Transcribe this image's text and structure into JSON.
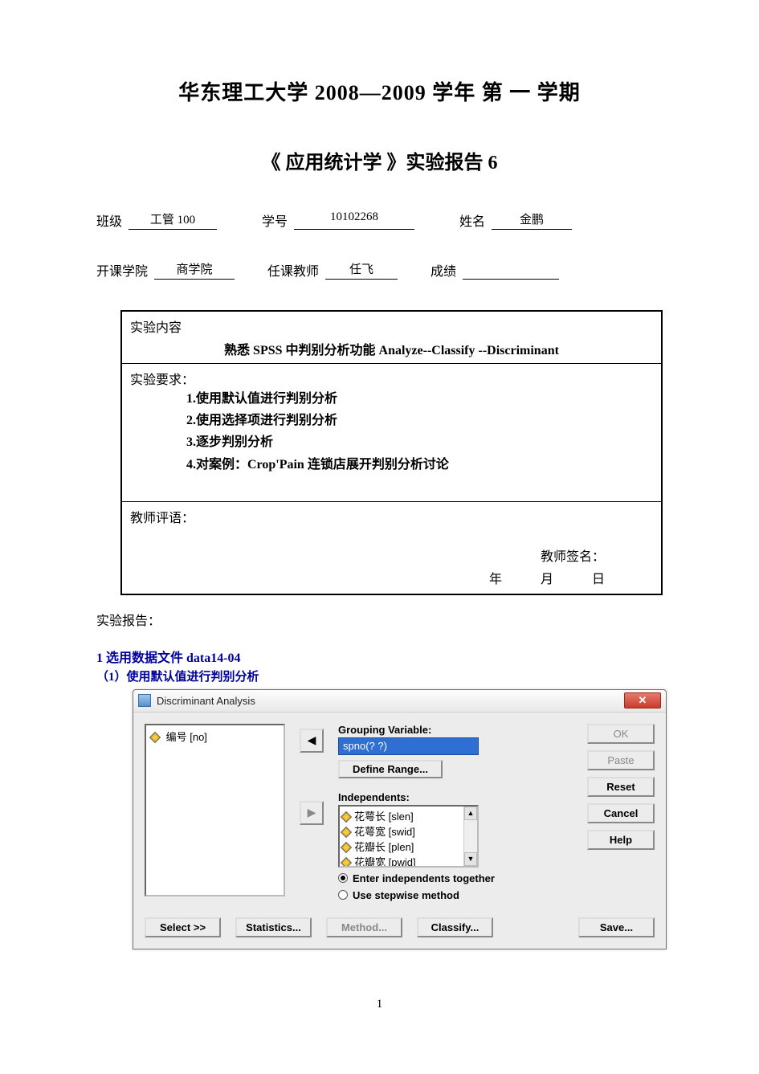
{
  "header": {
    "title": "华东理工大学 2008—2009  学年  第  一  学期",
    "subtitle": "《  应用统计学  》实验报告 6"
  },
  "info1": {
    "class_label": "班级",
    "class_value": "工管 100",
    "id_label": "学号",
    "id_value": "10102268",
    "name_label": "姓名",
    "name_value": "金鹏"
  },
  "info2": {
    "college_label": "开课学院",
    "college_value": "商学院",
    "teacher_label": "任课教师",
    "teacher_value": "任飞",
    "score_label": "成绩",
    "score_value": ""
  },
  "box": {
    "content_label": "实验内容",
    "content_text": "熟悉 SPSS 中判别分析功能 Analyze--Classify  --Discriminant",
    "req_label": "实验要求：",
    "reqs": [
      "1.使用默认值进行判别分析",
      "2.使用选择项进行判别分析",
      "3.逐步判别分析",
      "4.对案例：Crop'Pain 连锁店展开判别分析讨论"
    ],
    "comment_label": "教师评语：",
    "sig_label": "教师签名：",
    "date_y": "年",
    "date_m": "月",
    "date_d": "日"
  },
  "report_label": "实验报告：",
  "section": {
    "h": "1 选用数据文件 data14-04",
    "sub": "（1）使用默认值进行判别分析"
  },
  "dialog": {
    "title": "Discriminant Analysis",
    "close_x": "✕",
    "left_list_item": "编号 [no]",
    "arrow_left": "◀",
    "arrow_right": "▶",
    "grouping_label": "Grouping Variable:",
    "grouping_value": "spno(? ?)",
    "define_range": "Define Range...",
    "independents_label": "Independents:",
    "independents": [
      "花萼长 [slen]",
      "花萼宽 [swid]",
      "花瓣长 [plen]",
      "花瓣宽 [pwid]"
    ],
    "scroll_up": "▲",
    "scroll_down": "▼",
    "radio_together": "Enter independents together",
    "radio_stepwise": "Use stepwise method",
    "right": {
      "ok": "OK",
      "paste": "Paste",
      "reset": "Reset",
      "cancel": "Cancel",
      "help": "Help"
    },
    "bottom": {
      "select": "Select >>",
      "statistics": "Statistics...",
      "method": "Method...",
      "classify": "Classify...",
      "save": "Save..."
    }
  },
  "page_number": "1"
}
